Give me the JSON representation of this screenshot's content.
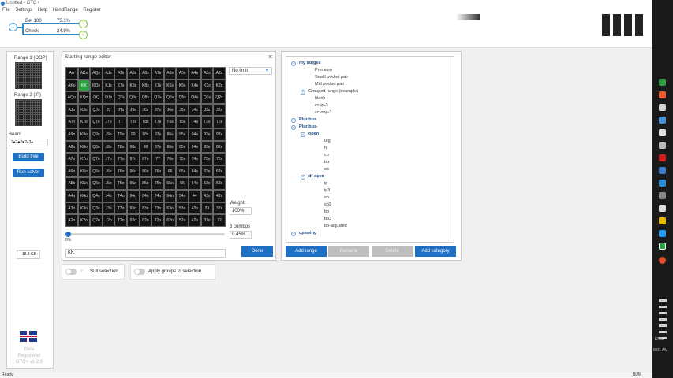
{
  "window": {
    "title": "Untitled - GTO+"
  },
  "menu": [
    "File",
    "Settings",
    "Help",
    "HandRange",
    "Register"
  ],
  "bet_tree": {
    "root_node": "1",
    "lines": [
      {
        "label": "Bet 100",
        "value": "75.1%",
        "node": "2"
      },
      {
        "label": "Check",
        "value": "24.9%",
        "node": "2"
      }
    ]
  },
  "left_panel": {
    "range1_label": "Range 1 (OOP)",
    "range2_label": "Range 2 (IP)",
    "board_label": "Board",
    "board_value": "2♠2♣2♥2♦3♠",
    "build_tree": "Build tree",
    "run_solver": "Run solver",
    "memory": "18.8 GB",
    "license_status": "Beta\nRegistered",
    "version": "GTO+ v1.2.9"
  },
  "range_editor": {
    "title": "Starting range editor",
    "close": "×",
    "game_type": "No limit",
    "game_type_arrow": "▼",
    "weight_label": "Weight:",
    "weight_value": "100%",
    "combos_label": "6 combos",
    "combos_value": "0.45%",
    "slider_value": "0%",
    "range_text": "KK",
    "done": "Done",
    "selected_hand": "KK",
    "hands": [
      [
        "AA",
        "AKs",
        "AQs",
        "AJs",
        "ATs",
        "A9s",
        "A8s",
        "A7s",
        "A6s",
        "A5s",
        "A4s",
        "A3s",
        "A2s"
      ],
      [
        "AKo",
        "KK",
        "KQs",
        "KJs",
        "KTs",
        "K9s",
        "K8s",
        "K7s",
        "K6s",
        "K5s",
        "K4s",
        "K3s",
        "K2s"
      ],
      [
        "AQo",
        "KQo",
        "QQ",
        "QJs",
        "QTs",
        "Q9s",
        "Q8s",
        "Q7s",
        "Q6s",
        "Q5s",
        "Q4s",
        "Q3s",
        "Q2s"
      ],
      [
        "AJo",
        "KJo",
        "QJo",
        "JJ",
        "JTs",
        "J9s",
        "J8s",
        "J7s",
        "J6s",
        "J5s",
        "J4s",
        "J3s",
        "J2s"
      ],
      [
        "ATo",
        "KTo",
        "QTo",
        "JTo",
        "TT",
        "T9s",
        "T8s",
        "T7s",
        "T6s",
        "T5s",
        "T4s",
        "T3s",
        "T2s"
      ],
      [
        "A9o",
        "K9o",
        "Q9o",
        "J9o",
        "T9o",
        "99",
        "98s",
        "97s",
        "96s",
        "95s",
        "94s",
        "93s",
        "92s"
      ],
      [
        "A8o",
        "K8o",
        "Q8o",
        "J8o",
        "T8o",
        "98o",
        "88",
        "87s",
        "86s",
        "85s",
        "84s",
        "83s",
        "82s"
      ],
      [
        "A7o",
        "K7o",
        "Q7o",
        "J7o",
        "T7o",
        "97o",
        "87o",
        "77",
        "76s",
        "75s",
        "74s",
        "73s",
        "72s"
      ],
      [
        "A6o",
        "K6o",
        "Q6o",
        "J6o",
        "T6o",
        "96o",
        "86o",
        "76o",
        "66",
        "65s",
        "64s",
        "63s",
        "62s"
      ],
      [
        "A5o",
        "K5o",
        "Q5o",
        "J5o",
        "T5o",
        "95o",
        "85o",
        "75o",
        "65o",
        "55",
        "54s",
        "53s",
        "52s"
      ],
      [
        "A4o",
        "K4o",
        "Q4o",
        "J4o",
        "T4o",
        "94o",
        "84o",
        "74o",
        "64o",
        "54o",
        "44",
        "43s",
        "42s"
      ],
      [
        "A3o",
        "K3o",
        "Q3o",
        "J3o",
        "T3o",
        "93o",
        "83o",
        "73o",
        "63o",
        "53o",
        "43o",
        "33",
        "32s"
      ],
      [
        "A2o",
        "K2o",
        "Q2o",
        "J2o",
        "T2o",
        "92o",
        "82o",
        "72o",
        "62o",
        "52o",
        "42o",
        "32o",
        "22"
      ]
    ]
  },
  "toggles": [
    {
      "label": "Suit selection"
    },
    {
      "label": "Apply groups to selection"
    }
  ],
  "range_tree": {
    "items": [
      {
        "label": "my ranges",
        "expand": "−",
        "bold": true
      },
      {
        "label": "Premium"
      },
      {
        "label": "Small pocket pair"
      },
      {
        "label": "Mid pocket pair"
      },
      {
        "label": "Grouped range (example)",
        "expand": "+"
      },
      {
        "label": "blank"
      },
      {
        "label": "cc-ip-3"
      },
      {
        "label": "cc-oop-3"
      },
      {
        "label": "Pluribus",
        "expand": "+",
        "bold": true
      },
      {
        "label": "Pluribus-",
        "expand": "−",
        "bold": true
      },
      {
        "label": "open",
        "expand": "−",
        "bold": true
      },
      {
        "label": "utg"
      },
      {
        "label": "hj"
      },
      {
        "label": "co"
      },
      {
        "label": "bu"
      },
      {
        "label": "sb"
      },
      {
        "label": "df-open",
        "expand": "−",
        "bold": true
      },
      {
        "label": "ip"
      },
      {
        "label": "ip3"
      },
      {
        "label": "sb"
      },
      {
        "label": "sb3"
      },
      {
        "label": "bb"
      },
      {
        "label": "bb3"
      },
      {
        "label": "bb-adjusted"
      },
      {
        "label": "upswing",
        "expand": "−",
        "bold": true
      }
    ],
    "buttons": {
      "add_range": "Add range",
      "rename": "Rename",
      "delete": "Delete",
      "add_category": "Add category"
    }
  },
  "status": {
    "left": "Ready",
    "right": "NUM"
  },
  "taskbar": {
    "time": "8:01 AM",
    "lang": "ENG"
  }
}
